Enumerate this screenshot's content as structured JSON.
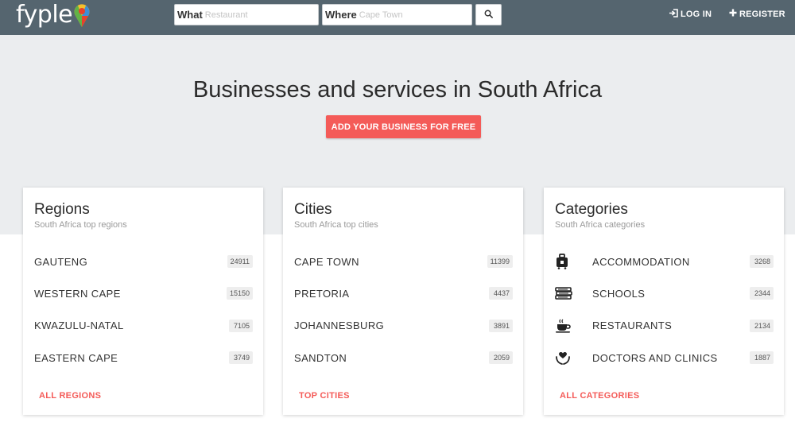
{
  "header": {
    "logo_text": "fyple",
    "what_label": "What",
    "what_placeholder": "Restaurant",
    "where_label": "Where",
    "where_placeholder": "Cape Town",
    "login_label": "LOG IN",
    "register_label": "REGISTER",
    "background_color": "#55656f"
  },
  "hero": {
    "title": "Businesses and services in South Africa",
    "cta_label": "ADD YOUR BUSINESS FOR FREE",
    "cta_color": "#f45b58"
  },
  "regions": {
    "title": "Regions",
    "subtitle": "South Africa top regions",
    "items": [
      {
        "label": "GAUTENG",
        "count": "24911"
      },
      {
        "label": "WESTERN CAPE",
        "count": "15150"
      },
      {
        "label": "KWAZULU-NATAL",
        "count": "7105"
      },
      {
        "label": "EASTERN CAPE",
        "count": "3749"
      }
    ],
    "footer_link": "ALL REGIONS"
  },
  "cities": {
    "title": "Cities",
    "subtitle": "South Africa top cities",
    "items": [
      {
        "label": "CAPE TOWN",
        "count": "11399"
      },
      {
        "label": "PRETORIA",
        "count": "4437"
      },
      {
        "label": "JOHANNESBURG",
        "count": "3891"
      },
      {
        "label": "SANDTON",
        "count": "2059"
      }
    ],
    "footer_link": "TOP CITIES"
  },
  "categories": {
    "title": "Categories",
    "subtitle": "South Africa categories",
    "items": [
      {
        "label": "ACCOMMODATION",
        "count": "3268",
        "icon": "suitcase-icon"
      },
      {
        "label": "SCHOOLS",
        "count": "2344",
        "icon": "books-icon"
      },
      {
        "label": "RESTAURANTS",
        "count": "2134",
        "icon": "coffee-cup-icon"
      },
      {
        "label": "DOCTORS AND CLINICS",
        "count": "1887",
        "icon": "heart-hands-icon"
      }
    ],
    "footer_link": "ALL CATEGORIES"
  }
}
